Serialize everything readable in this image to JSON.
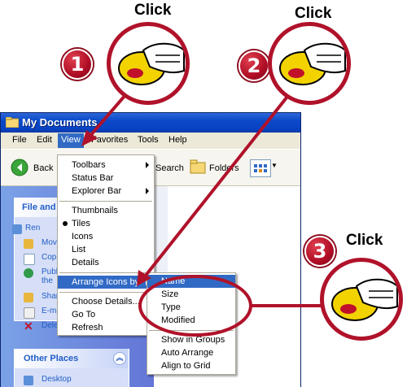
{
  "callouts": {
    "click1": "Click",
    "click2": "Click",
    "click3": "Click",
    "num1": "1",
    "num2": "2",
    "num3": "3"
  },
  "window": {
    "title": "My Documents",
    "menus": [
      "File",
      "Edit",
      "View",
      "Favorites",
      "Tools",
      "Help"
    ],
    "toolbar": {
      "back": "Back",
      "search": "Search",
      "folders": "Folders"
    },
    "taskpane": {
      "file_header": "File and",
      "tasks": [
        "Ren",
        "Mov",
        "Cop",
        "Publ",
        "the",
        "Shar",
        "E-ma",
        "Dele"
      ],
      "other_places": "Other Places",
      "desktop": "Desktop"
    }
  },
  "view_menu": {
    "items": [
      "Toolbars",
      "Status Bar",
      "Explorer Bar",
      "Thumbnails",
      "Tiles",
      "Icons",
      "List",
      "Details",
      "Arrange Icons by",
      "Choose Details...",
      "Go To",
      "Refresh"
    ],
    "selected": "Tiles",
    "highlighted": "Arrange Icons by"
  },
  "arrange_menu": {
    "items": [
      "Name",
      "Size",
      "Type",
      "Modified",
      "Show in Groups",
      "Auto Arrange",
      "Align to Grid"
    ],
    "highlighted": "Name"
  },
  "colors": {
    "accent_red": "#b0122a",
    "highlight_blue": "#316ac5",
    "titlebar_blue": "#0a49c9"
  }
}
